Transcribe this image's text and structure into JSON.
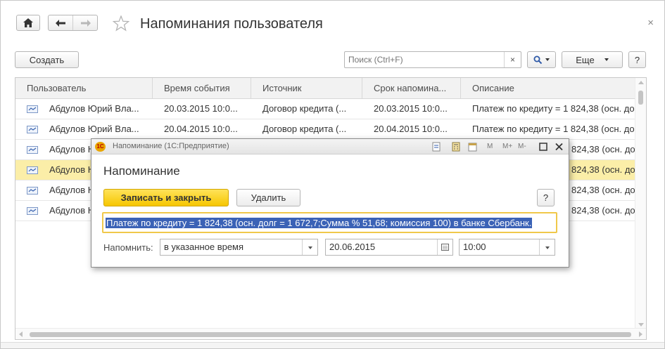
{
  "window": {
    "title": "Напоминания пользователя",
    "close_glyph": "×"
  },
  "toolbar": {
    "home_icon": "home-icon",
    "back_icon": "arrow-left-icon",
    "forward_icon": "arrow-right-icon",
    "favorite_icon": "star-icon",
    "create_label": "Создать",
    "search_placeholder": "Поиск (Ctrl+F)",
    "search_clear": "×",
    "more_label": "Еще",
    "help_label": "?"
  },
  "table": {
    "columns": [
      "Пользователь",
      "Время события",
      "Источник",
      "Срок напомина...",
      "Описание"
    ],
    "rows": [
      {
        "user": "Абдулов Юрий Вла...",
        "event_time": "20.03.2015 10:0...",
        "source": "Договор кредита (...",
        "deadline": "20.03.2015 10:0...",
        "description": "Платеж по кредиту = 1 824,38 (осн. до",
        "selected": false
      },
      {
        "user": "Абдулов Юрий Вла...",
        "event_time": "20.04.2015 10:0...",
        "source": "Договор кредита (...",
        "deadline": "20.04.2015 10:0...",
        "description": "Платеж по кредиту = 1 824,38 (осн. до",
        "selected": false
      },
      {
        "user": "Абдулов Ю",
        "event_time": "",
        "source": "",
        "deadline": "",
        "description": "824,38 (осн. до",
        "selected": false
      },
      {
        "user": "Абдулов Ю",
        "event_time": "",
        "source": "",
        "deadline": "",
        "description": "824,38 (осн. до",
        "selected": true
      },
      {
        "user": "Абдулов Ю",
        "event_time": "",
        "source": "",
        "deadline": "",
        "description": "824,38 (осн. до",
        "selected": false
      },
      {
        "user": "Абдулов Ю",
        "event_time": "",
        "source": "",
        "deadline": "",
        "description": "824,38 (осн. до",
        "selected": false
      }
    ]
  },
  "dialog": {
    "caption": "Напоминание  (1С:Предприятие)",
    "heading": "Напоминание",
    "save_close_label": "Записать и закрыть",
    "delete_label": "Удалить",
    "help_label": "?",
    "reminder_text": "Платеж по кредиту = 1 824,38 (осн. долг = 1 672,7;Сумма % 51,68; комиссия 100) в банке Сбербанк.",
    "remind_label": "Напомнить:",
    "remind_mode": "в указанное время",
    "date": "20.06.2015",
    "time": "10:00",
    "titlebar_buttons": [
      "M",
      "M+",
      "M-"
    ]
  },
  "colors": {
    "accent_yellow": "#f6c600",
    "selected_row": "#fbeea8",
    "text_highlight": "#3b62b6"
  }
}
